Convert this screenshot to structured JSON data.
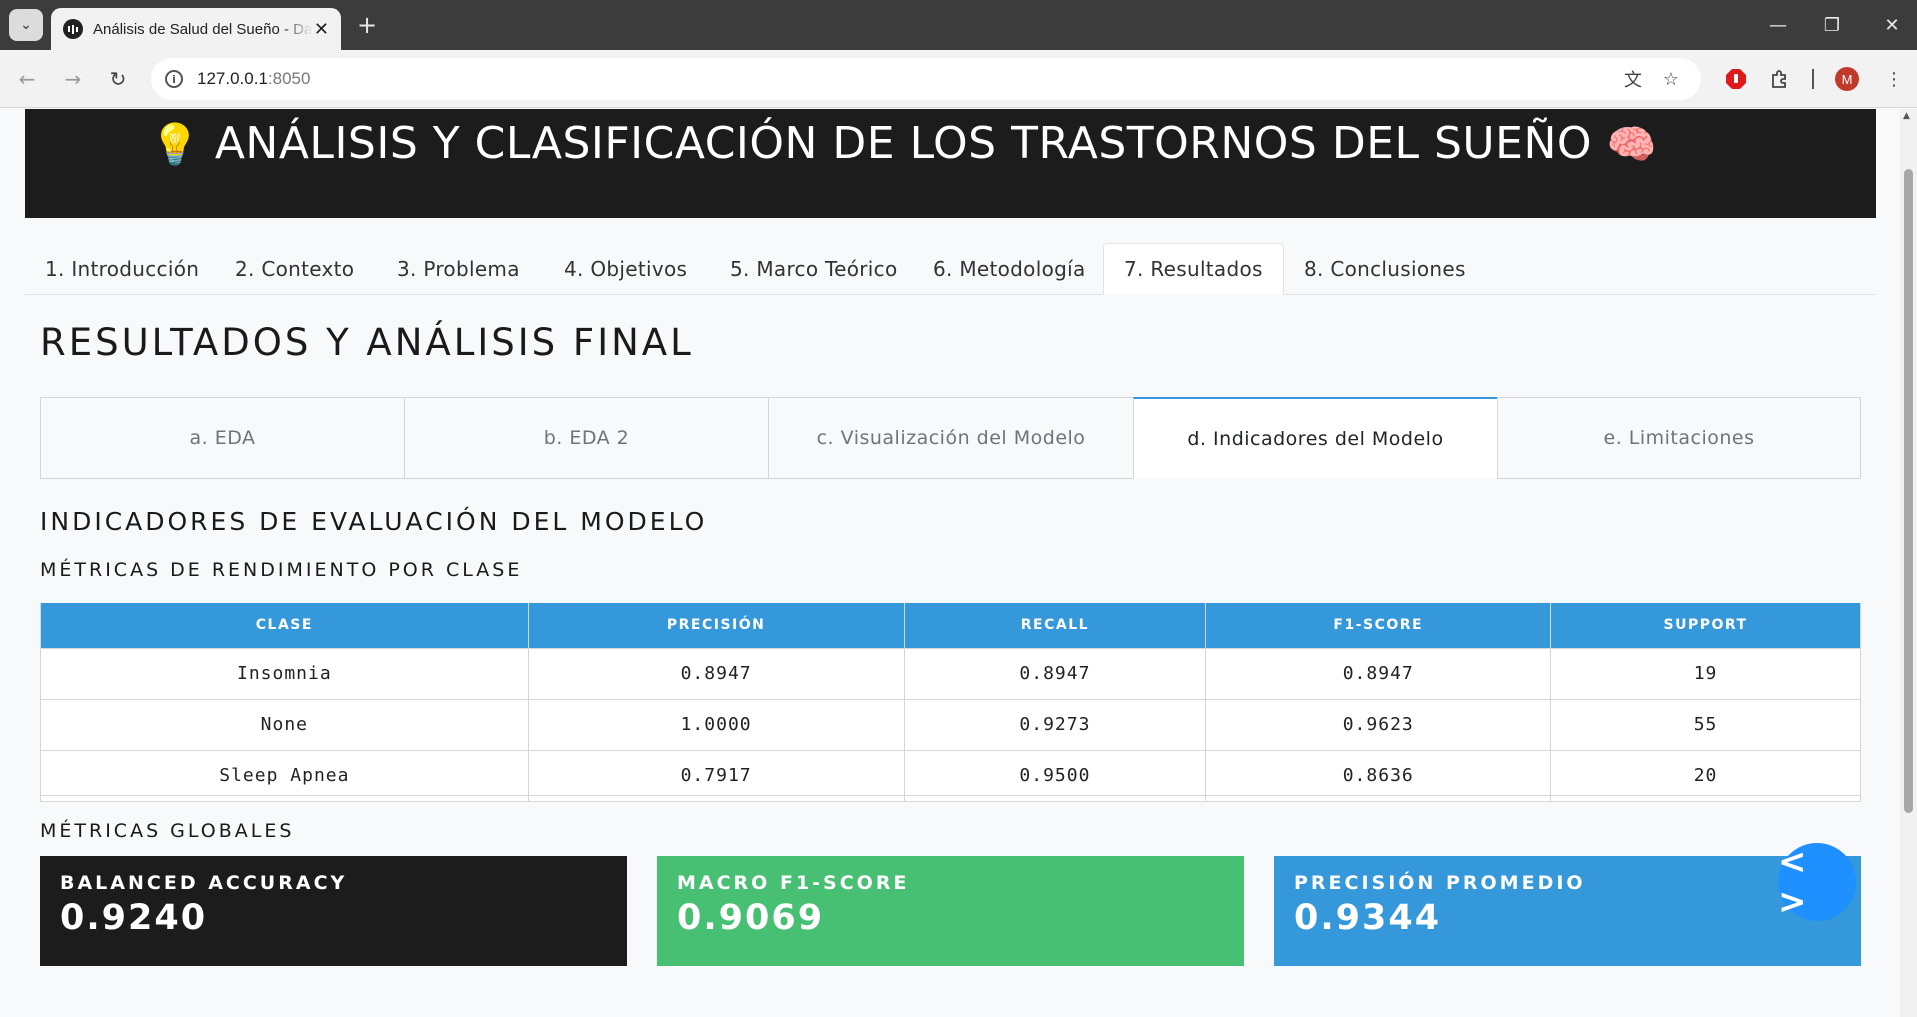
{
  "browser": {
    "tab_title": "Análisis de Salud del Sueño - Dash",
    "tab_close": "✕",
    "new_tab": "+",
    "url_host": "127.0.0.1",
    "url_port": ":8050",
    "avatar_initial": "M"
  },
  "header": {
    "emoji_left": "💡",
    "title": "ANÁLISIS Y CLASIFICACIÓN DE LOS TRASTORNOS DEL SUEÑO",
    "emoji_right": "🧠"
  },
  "main_tabs": [
    {
      "label": "1. Introducción"
    },
    {
      "label": "2. Contexto"
    },
    {
      "label": "3. Problema"
    },
    {
      "label": "4. Objetivos"
    },
    {
      "label": "5. Marco Teórico"
    },
    {
      "label": "6. Metodología"
    },
    {
      "label": "7. Resultados"
    },
    {
      "label": "8. Conclusiones"
    }
  ],
  "main_tab_selected": "7. Resultados",
  "section_title": "RESULTADOS Y ANÁLISIS FINAL",
  "sub_tabs": [
    {
      "label": "a. EDA"
    },
    {
      "label": "b. EDA 2"
    },
    {
      "label": "c. Visualización del Modelo"
    },
    {
      "label": "d. Indicadores del Modelo"
    },
    {
      "label": "e. Limitaciones"
    }
  ],
  "sub_tab_selected": "d. Indicadores del Modelo",
  "indicators_title": "INDICADORES DE EVALUACIÓN DEL MODELO",
  "class_metrics_title": "MÉTRICAS DE RENDIMIENTO POR CLASE",
  "table": {
    "headers": [
      "CLASE",
      "PRECISIÓN",
      "RECALL",
      "F1-SCORE",
      "SUPPORT"
    ],
    "rows": [
      [
        "Insomnia",
        "0.8947",
        "0.8947",
        "0.8947",
        "19"
      ],
      [
        "None",
        "1.0000",
        "0.9273",
        "0.9623",
        "55"
      ],
      [
        "Sleep Apnea",
        "0.7917",
        "0.9500",
        "0.8636",
        "20"
      ]
    ]
  },
  "global_metrics_title": "MÉTRICAS GLOBALES",
  "cards": [
    {
      "label": "BALANCED ACCURACY",
      "value": "0.9240",
      "color": "#1c1c1c"
    },
    {
      "label": "MACRO F1-SCORE",
      "value": "0.9069",
      "color": "#48c074"
    },
    {
      "label": "PRECISIÓN PROMEDIO",
      "value": "0.9344",
      "color": "#3498db"
    }
  ],
  "fab_label": "< >"
}
